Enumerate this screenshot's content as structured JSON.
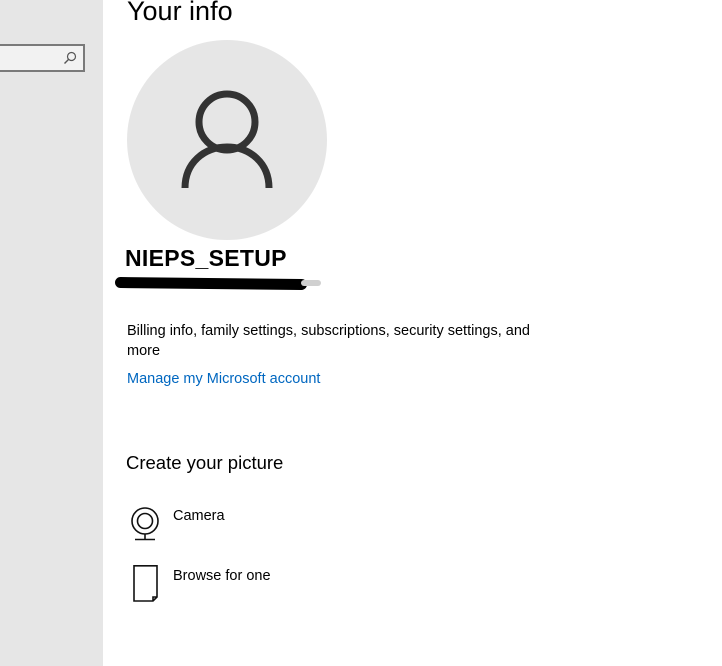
{
  "sidebar": {
    "search": {
      "value": "",
      "placeholder": "",
      "icon": "search-icon"
    }
  },
  "main": {
    "title": "Your info",
    "avatar_icon": "user-silhouette-icon",
    "user_name": "NIEPS_SETUP",
    "billing_text": "Billing info, family settings, subscriptions, security settings, and more",
    "manage_link": "Manage my Microsoft account",
    "section_title": "Create your picture",
    "picture_options": [
      {
        "label": "Camera",
        "icon": "camera-icon"
      },
      {
        "label": "Browse for one",
        "icon": "browse-file-icon"
      }
    ]
  },
  "colors": {
    "sidebar_bg": "#e6e6e6",
    "avatar_bg": "#e6e6e6",
    "link": "#0067c0",
    "text": "#000000"
  }
}
